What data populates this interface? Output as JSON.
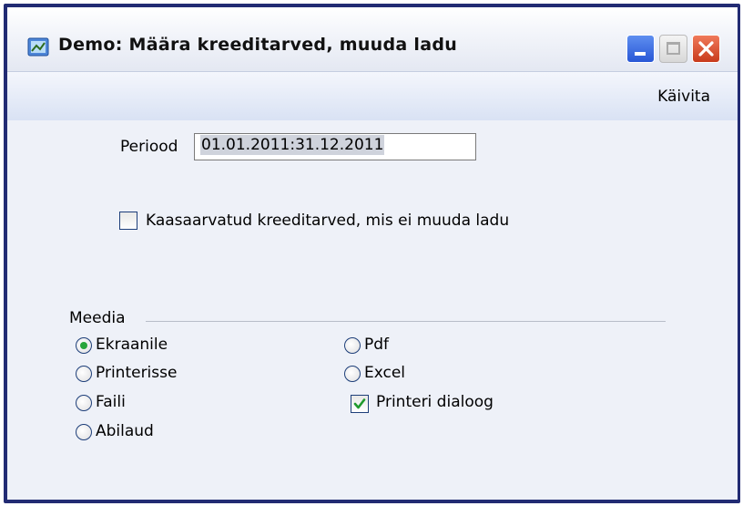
{
  "window": {
    "title": "Demo: Määra kreeditarved, muuda ladu"
  },
  "toolbar": {
    "run_label": "Käivita"
  },
  "form": {
    "period_label": "Periood",
    "period_value": "01.01.2011:31.12.2011",
    "include_credit_label": "Kaasaarvatud kreeditarved, mis ei muuda ladu",
    "include_credit_checked": false
  },
  "media": {
    "legend": "Meedia",
    "options": [
      {
        "label": "Ekraanile",
        "selected": true
      },
      {
        "label": "Printerisse",
        "selected": false
      },
      {
        "label": "Faili",
        "selected": false
      },
      {
        "label": "Abilaud",
        "selected": false
      },
      {
        "label": "Pdf",
        "selected": false
      },
      {
        "label": "Excel",
        "selected": false
      }
    ],
    "printer_dialog_label": "Printeri dialoog",
    "printer_dialog_checked": true
  },
  "colors": {
    "frame": "#222b73",
    "radio_dot": "#27a53a",
    "checkmark": "#1f9a2c"
  }
}
